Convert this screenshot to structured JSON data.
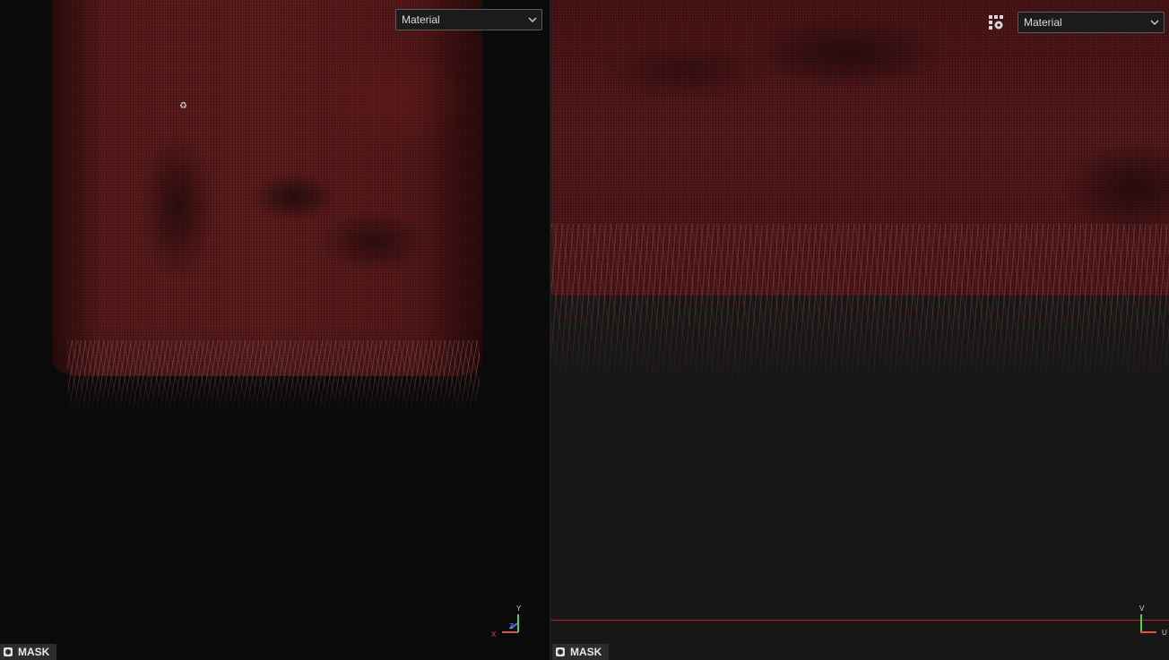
{
  "viewports": {
    "view3d": {
      "shading_mode": "Material",
      "mask_label": "MASK",
      "axis_labels": {
        "y": "Y",
        "x": "X",
        "z": "Z"
      }
    },
    "view2d": {
      "shading_mode": "Material",
      "mask_label": "MASK",
      "axis_labels": {
        "v": "V",
        "u": "U"
      }
    }
  },
  "icons": {
    "dropdown": "chevron-down-icon",
    "display_settings": "grid-settings-icon",
    "mask": "mask-icon",
    "cursor": "brush-cursor-icon"
  },
  "colors": {
    "fabric": "#581a1c",
    "uv_border": "#c81e1e",
    "axis_x": "#e05050",
    "axis_y": "#50d050",
    "axis_z": "#5070f0"
  }
}
